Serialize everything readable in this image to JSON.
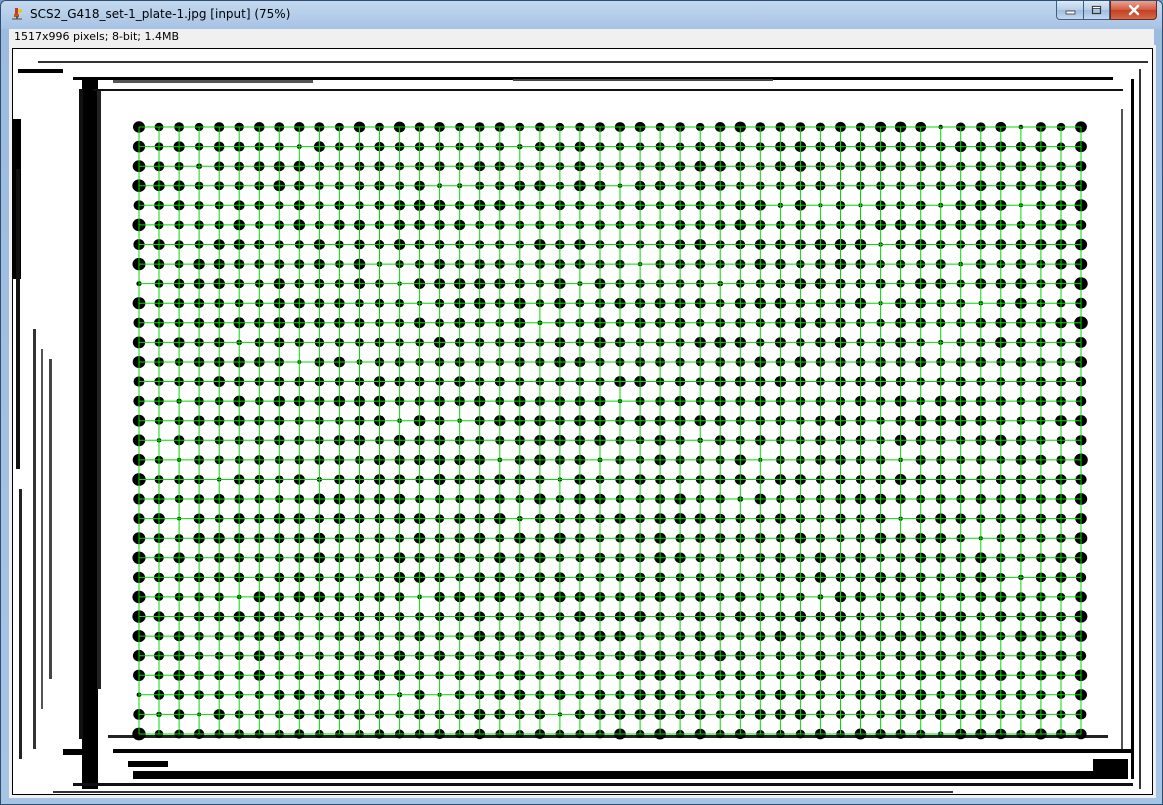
{
  "window": {
    "title": "SCS2_G418_set-1_plate-1.jpg [input] (75%)",
    "info": "1517x996 pixels; 8-bit; 1.4MB",
    "icon": "imagej-microscope-icon"
  },
  "caption_buttons": {
    "minimize": "minimize-icon",
    "maximize": "maximize-icon",
    "close": "close-icon"
  },
  "plate": {
    "grid_rows": 32,
    "grid_cols": 48,
    "grid_color": "#00dd00",
    "colony_color": "#000000"
  }
}
